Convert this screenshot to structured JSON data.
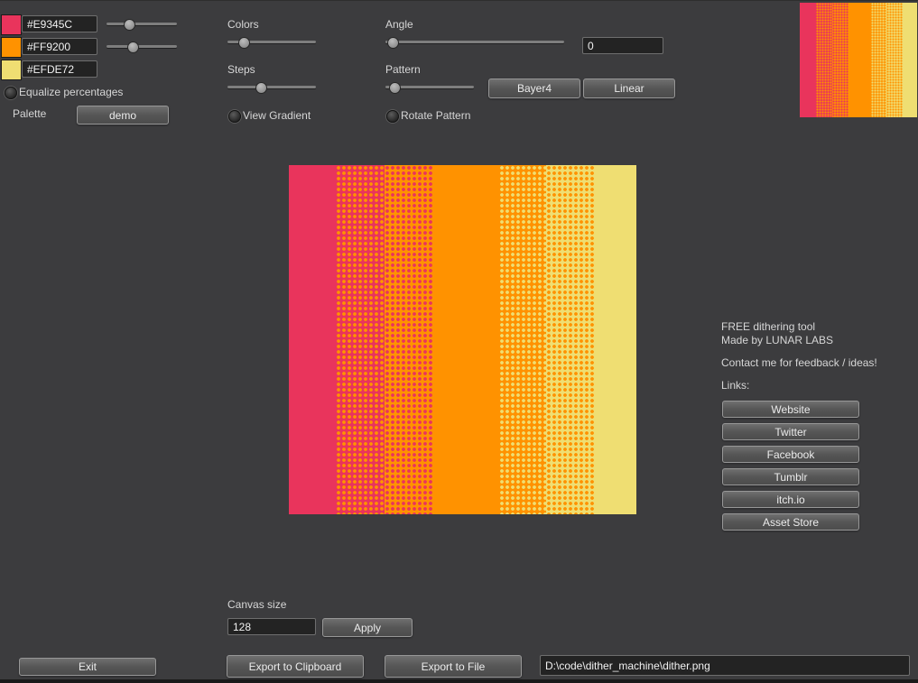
{
  "palette_panel": {
    "swatches": [
      {
        "hex": "#E9345C",
        "slider": 32
      },
      {
        "hex": "#FF9200",
        "slider": 37
      },
      {
        "hex": "#EFDE72"
      }
    ],
    "equalize_label": "Equalize percentages",
    "palette_label": "Palette",
    "palette_value": "demo"
  },
  "gradient_controls": {
    "colors_label": "Colors",
    "colors_slider": 18,
    "steps_label": "Steps",
    "steps_slider": 38,
    "view_gradient_label": "View Gradient"
  },
  "pattern_controls": {
    "angle_label": "Angle",
    "angle_slider": 4,
    "angle_value": "0",
    "pattern_label": "Pattern",
    "pattern_slider": 10,
    "bayer_button": "Bayer4",
    "linear_button": "Linear",
    "rotate_label": "Rotate Pattern"
  },
  "info": {
    "line1": "FREE dithering tool",
    "line2": "Made by LUNAR LABS",
    "contact": "Contact me for feedback / ideas!",
    "links_label": "Links:",
    "links": [
      "Website",
      "Twitter",
      "Facebook",
      "Tumblr",
      "itch.io",
      "Asset Store"
    ]
  },
  "canvas_controls": {
    "label": "Canvas size",
    "value": "128",
    "apply_button": "Apply"
  },
  "footer": {
    "exit_button": "Exit",
    "clipboard_button": "Export to Clipboard",
    "file_button": "Export to File",
    "path": "D:\\code\\dither_machine\\dither.png"
  },
  "dither_canvas": {
    "dot_spacing": 6,
    "dot_radius": 1.7,
    "bands": [
      {
        "color": "#E9345C",
        "w": 13.5
      },
      {
        "color": "#E9345C",
        "dots": "#FF9200",
        "w": 14
      },
      {
        "color": "#FF9200",
        "dots": "#E9345C",
        "w": 14
      },
      {
        "color": "#FF9200",
        "w": 19
      },
      {
        "color": "#FF9200",
        "dots": "#EFDE72",
        "w": 13.5
      },
      {
        "color": "#EFDE72",
        "dots": "#FF9200",
        "w": 14
      },
      {
        "color": "#EFDE72",
        "w": 12
      }
    ]
  },
  "dither_preview": {
    "dot_spacing": 3,
    "dot_radius": 0.9,
    "bands": [
      {
        "color": "#E9345C",
        "w": 13.5
      },
      {
        "color": "#E9345C",
        "dots": "#FF9200",
        "w": 14
      },
      {
        "color": "#FF9200",
        "dots": "#E9345C",
        "w": 14
      },
      {
        "color": "#FF9200",
        "w": 19
      },
      {
        "color": "#FF9200",
        "dots": "#EFDE72",
        "w": 13.5
      },
      {
        "color": "#EFDE72",
        "dots": "#FF9200",
        "w": 14
      },
      {
        "color": "#EFDE72",
        "w": 12
      }
    ]
  }
}
